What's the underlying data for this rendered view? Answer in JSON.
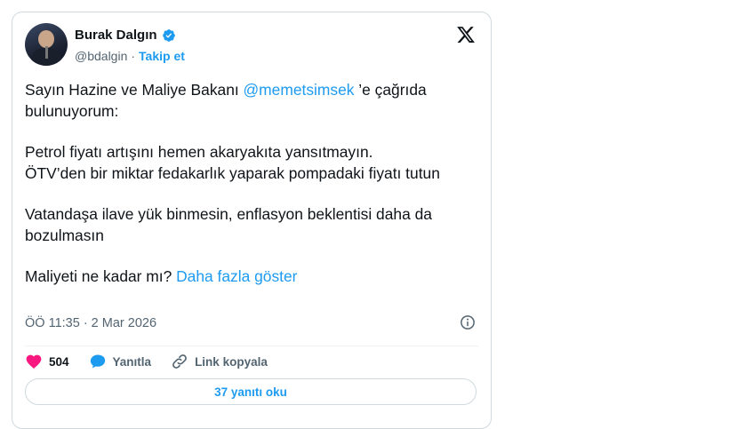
{
  "author": {
    "name": "Burak Dalgın",
    "handle": "@bdalgin",
    "separator": "·",
    "follow_label": "Takip et"
  },
  "tweet": {
    "line1_prefix": "Sayın Hazine ve Maliye Bakanı ",
    "mention": "@memetsimsek",
    "line1_suffix": " ’e çağrıda bulunuyorum:",
    "paragraph2": "Petrol fiyatı artışını hemen akaryakıta yansıtmayın.\nÖTV’den bir miktar fedakarlık yaparak pompadaki fiyatı tutun",
    "paragraph3": "Vatandaşa ilave yük binmesin, enflasyon beklentisi daha da bozulmasın",
    "paragraph4_prefix": "Maliyeti ne kadar mı? ",
    "show_more": "Daha fazla göster"
  },
  "meta": {
    "timestamp": "ÖÖ 11:35 · 2 Mar 2026"
  },
  "actions": {
    "like_count": "504",
    "reply_label": "Yanıtla",
    "copy_link_label": "Link kopyala"
  },
  "replies_button": "37 yanıtı oku",
  "colors": {
    "accent": "#1d9bf0",
    "like": "#f91880",
    "text": "#0f1419",
    "muted": "#536471",
    "border": "#cfd9de"
  }
}
